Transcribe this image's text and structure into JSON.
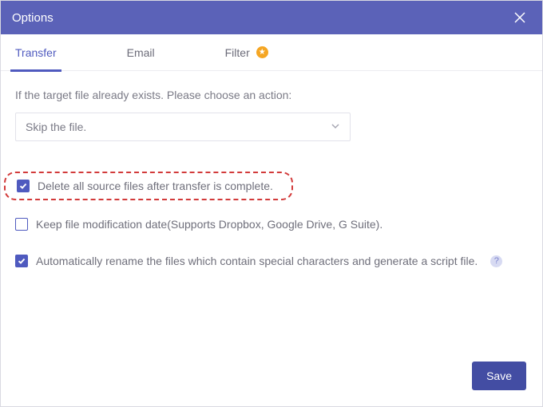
{
  "title": "Options",
  "tabs": {
    "transfer": "Transfer",
    "email": "Email",
    "filter": "Filter"
  },
  "prompt": "If the target file already exists. Please choose an action:",
  "select_value": "Skip the file.",
  "options": {
    "delete_source": "Delete all source files after transfer is complete.",
    "keep_mtime": "Keep file modification date(Supports Dropbox, Google Drive, G Suite).",
    "auto_rename": "Automatically rename the files which contain special characters and generate a script file."
  },
  "save_label": "Save"
}
